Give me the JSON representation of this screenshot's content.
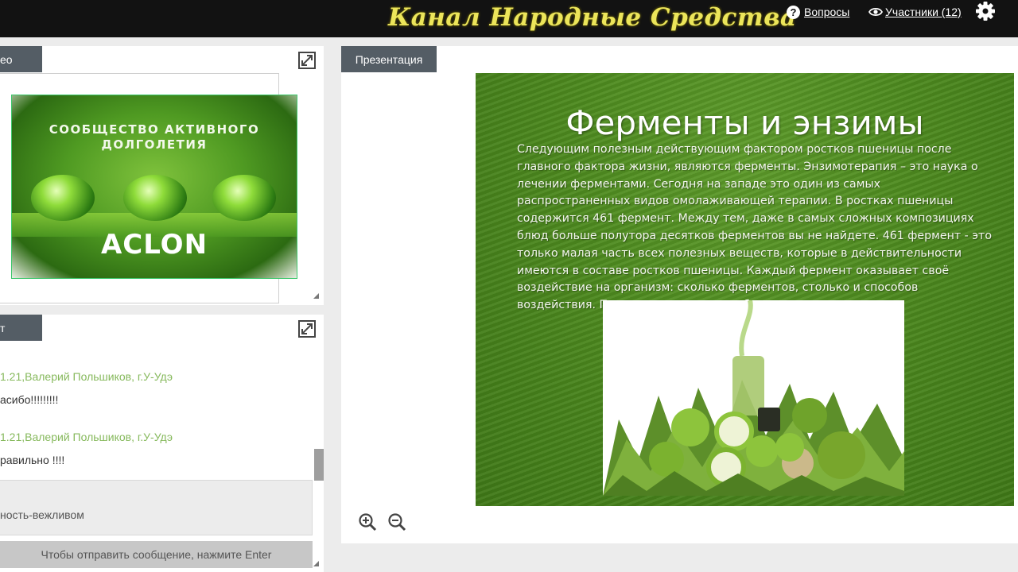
{
  "header": {
    "brand": "Канал Народные Средства",
    "questions_label": "Вопросы",
    "participants_label": "Участники (12)"
  },
  "video_panel": {
    "tab_label": "ео",
    "logo_tagline": "СООБЩЕСТВО АКТИВНОГО ДОЛГОЛЕТИЯ",
    "logo_name": "ACLON"
  },
  "chat_panel": {
    "tab_label": "т",
    "messages": [
      {
        "author": "1.21,Валерий Польшиков, г.У-Удэ",
        "text": "асибо!!!!!!!!!"
      },
      {
        "author": "1.21,Валерий Польшиков, г.У-Удэ",
        "text": "равильно !!!!"
      }
    ],
    "input_value": "ность-вежливом",
    "send_hint": "Чтобы отправить сообщение, нажмите Enter"
  },
  "presentation_panel": {
    "tab_label": "Презентация",
    "slide": {
      "title": "Ферменты и энзимы",
      "body": "Следующим полезным действующим фактором ростков пшеницы после главного фактора жизни, являются ферменты. Энзимотерапия – это наука о лечении ферментами. Сегодня на западе это один из самых распространенных видов омолаживающей терапии. В ростках пшеницы содержится 461 фермент. Между тем, даже в самых сложных композициях блюд больше полутора десятков ферментов вы не найдете. 461 фермент - это только малая часть всех полезных веществ, которые в действительности имеются в составе ростков пшеницы. Каждый фермент оказывает своё воздействие на организм: сколько ферментов, столько и способов воздействия. Попытаемся, однако, собрать их воедино."
    }
  },
  "colors": {
    "topbar": "#121212",
    "brand": "#ece55a",
    "tab": "#545d65",
    "chat_author": "#86b95c",
    "slide_green": "#4d8a1f"
  },
  "icons": [
    "question-icon",
    "eye-icon",
    "gear-icon",
    "expand-icon",
    "zoom-in-icon",
    "zoom-out-icon"
  ]
}
